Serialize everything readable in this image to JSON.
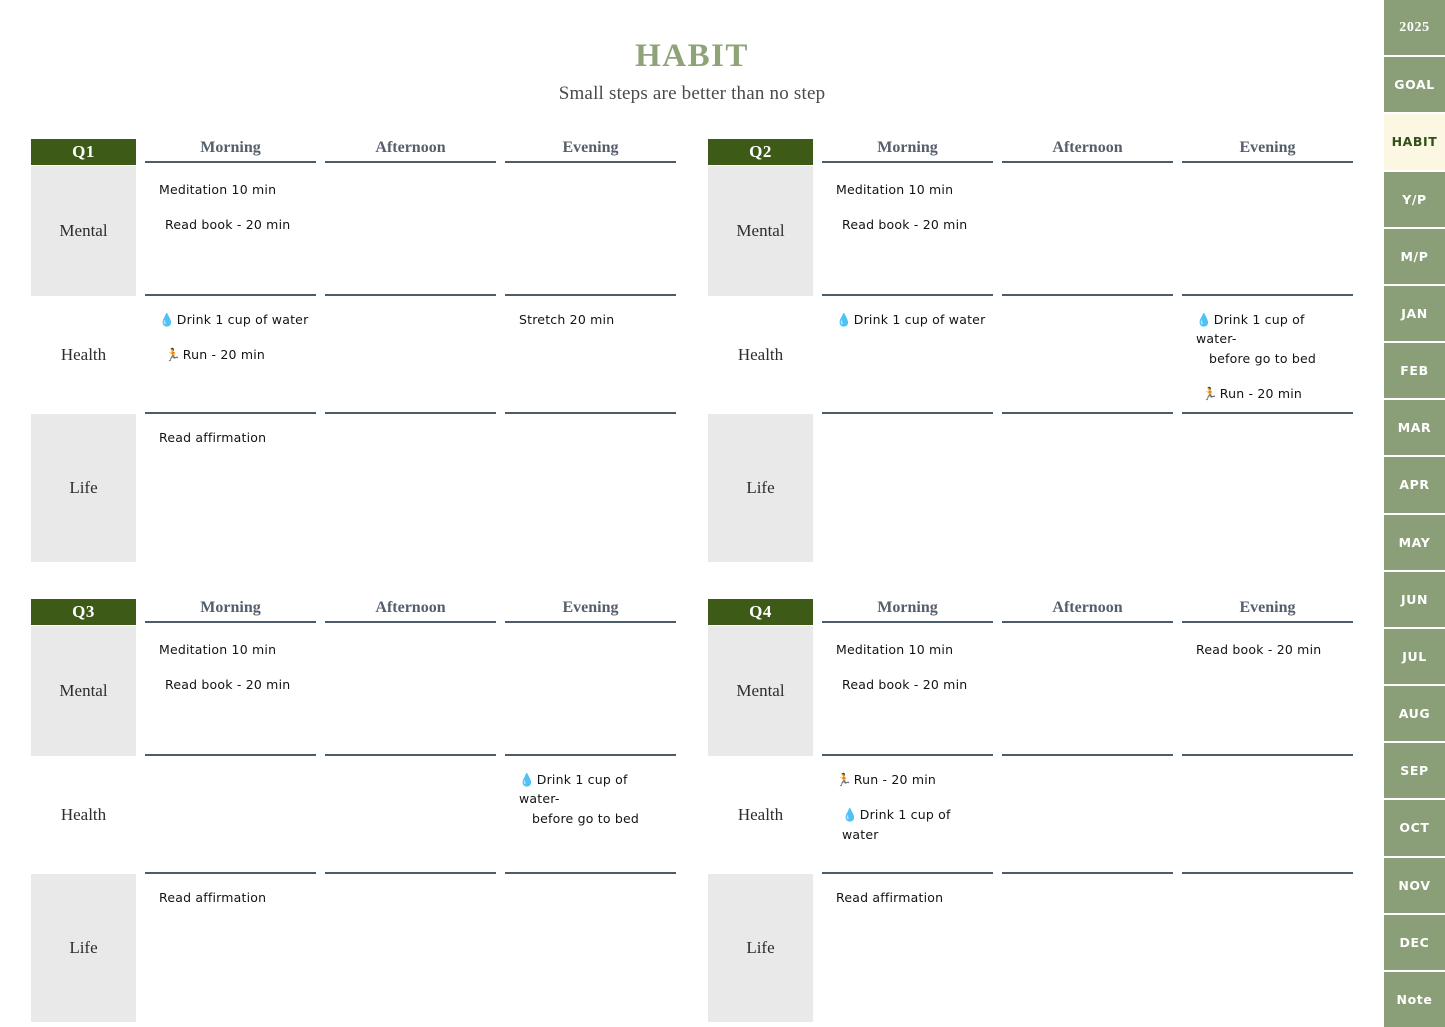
{
  "header": {
    "title": "HABIT",
    "subtitle": "Small steps are better than no step",
    "title_color": "#8fa378"
  },
  "columns": [
    "Morning",
    "Afternoon",
    "Evening"
  ],
  "categories": [
    "Mental",
    "Health",
    "Life"
  ],
  "theme": {
    "chip_green": "#3e5a17",
    "sidebar_green": "#8a9f77",
    "active_tab_bg": "#fcf7e3",
    "active_tab_text": "#2f5117",
    "shaded_cell": "#e9e9e9",
    "rule_color": "#4d5c6b"
  },
  "quadrants": [
    {
      "label": "Q1",
      "rows": [
        {
          "category": "Mental",
          "morning": [
            "Meditation 10 min",
            "Read book - 20 min"
          ],
          "afternoon": [],
          "evening": []
        },
        {
          "category": "Health",
          "morning": [
            "💧Drink 1 cup of water",
            "🏃Run - 20 min"
          ],
          "afternoon": [],
          "evening": [
            "Stretch 20 min"
          ]
        },
        {
          "category": "Life",
          "morning": [
            "Read affirmation"
          ],
          "afternoon": [],
          "evening": []
        }
      ]
    },
    {
      "label": "Q2",
      "rows": [
        {
          "category": "Mental",
          "morning": [
            "Meditation 10 min",
            "Read book - 20 min"
          ],
          "afternoon": [],
          "evening": []
        },
        {
          "category": "Health",
          "morning": [
            "💧Drink 1 cup of water"
          ],
          "afternoon": [],
          "evening": [
            "💧Drink 1 cup of water-\nbefore go to bed",
            "🏃Run - 20 min"
          ]
        },
        {
          "category": "Life",
          "morning": [],
          "afternoon": [],
          "evening": []
        }
      ]
    },
    {
      "label": "Q3",
      "rows": [
        {
          "category": "Mental",
          "morning": [
            "Meditation 10 min",
            "Read book - 20 min"
          ],
          "afternoon": [],
          "evening": []
        },
        {
          "category": "Health",
          "morning": [],
          "afternoon": [],
          "evening": [
            "💧Drink 1 cup of water-\nbefore go to bed"
          ]
        },
        {
          "category": "Life",
          "morning": [
            "Read affirmation"
          ],
          "afternoon": [],
          "evening": []
        }
      ]
    },
    {
      "label": "Q4",
      "rows": [
        {
          "category": "Mental",
          "morning": [
            "Meditation 10 min",
            "Read book - 20 min"
          ],
          "afternoon": [],
          "evening": [
            "Read book - 20 min"
          ]
        },
        {
          "category": "Health",
          "morning": [
            "🏃Run - 20 min",
            "💧Drink 1 cup of water"
          ],
          "afternoon": [],
          "evening": []
        },
        {
          "category": "Life",
          "morning": [
            "Read affirmation"
          ],
          "afternoon": [],
          "evening": []
        }
      ]
    }
  ],
  "sidebar": {
    "tabs": [
      {
        "label": "2025",
        "active": false,
        "style": "serif"
      },
      {
        "label": "GOAL",
        "active": false,
        "style": "sans"
      },
      {
        "label": "HABIT",
        "active": true,
        "style": "sans"
      },
      {
        "label": "Y/P",
        "active": false,
        "style": "sans"
      },
      {
        "label": "M/P",
        "active": false,
        "style": "sans"
      },
      {
        "label": "JAN",
        "active": false,
        "style": "sans"
      },
      {
        "label": "FEB",
        "active": false,
        "style": "sans"
      },
      {
        "label": "MAR",
        "active": false,
        "style": "sans"
      },
      {
        "label": "APR",
        "active": false,
        "style": "sans"
      },
      {
        "label": "MAY",
        "active": false,
        "style": "sans"
      },
      {
        "label": "JUN",
        "active": false,
        "style": "sans"
      },
      {
        "label": "JUL",
        "active": false,
        "style": "sans"
      },
      {
        "label": "AUG",
        "active": false,
        "style": "sans"
      },
      {
        "label": "SEP",
        "active": false,
        "style": "sans"
      },
      {
        "label": "OCT",
        "active": false,
        "style": "sans"
      },
      {
        "label": "NOV",
        "active": false,
        "style": "sans"
      },
      {
        "label": "DEC",
        "active": false,
        "style": "sans"
      },
      {
        "label": "Note",
        "active": false,
        "style": "sans"
      }
    ]
  }
}
